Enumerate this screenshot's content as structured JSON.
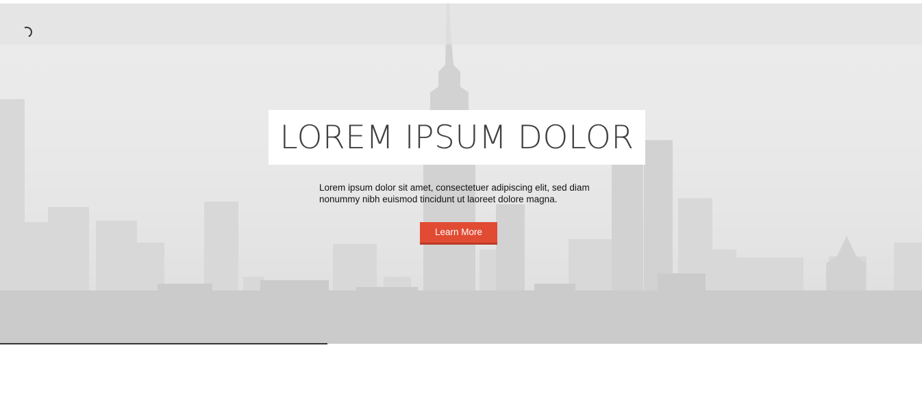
{
  "hero": {
    "title": "LOREM IPSUM DOLOR",
    "lead_line1": "Lorem ipsum dolor sit amet, consectetuer adipiscing elit, sed diam",
    "lead_line2": "nonummy nibh euismod tincidunt ut laoreet dolore magna.",
    "cta_label": "Learn More",
    "background": "city-skyline-image"
  },
  "loader": {
    "icon": "spinner-icon"
  },
  "slider_progress": {
    "fraction": 0.355
  },
  "colors": {
    "accent": "#e14b33",
    "title": "#404040",
    "progress": "#333333"
  }
}
